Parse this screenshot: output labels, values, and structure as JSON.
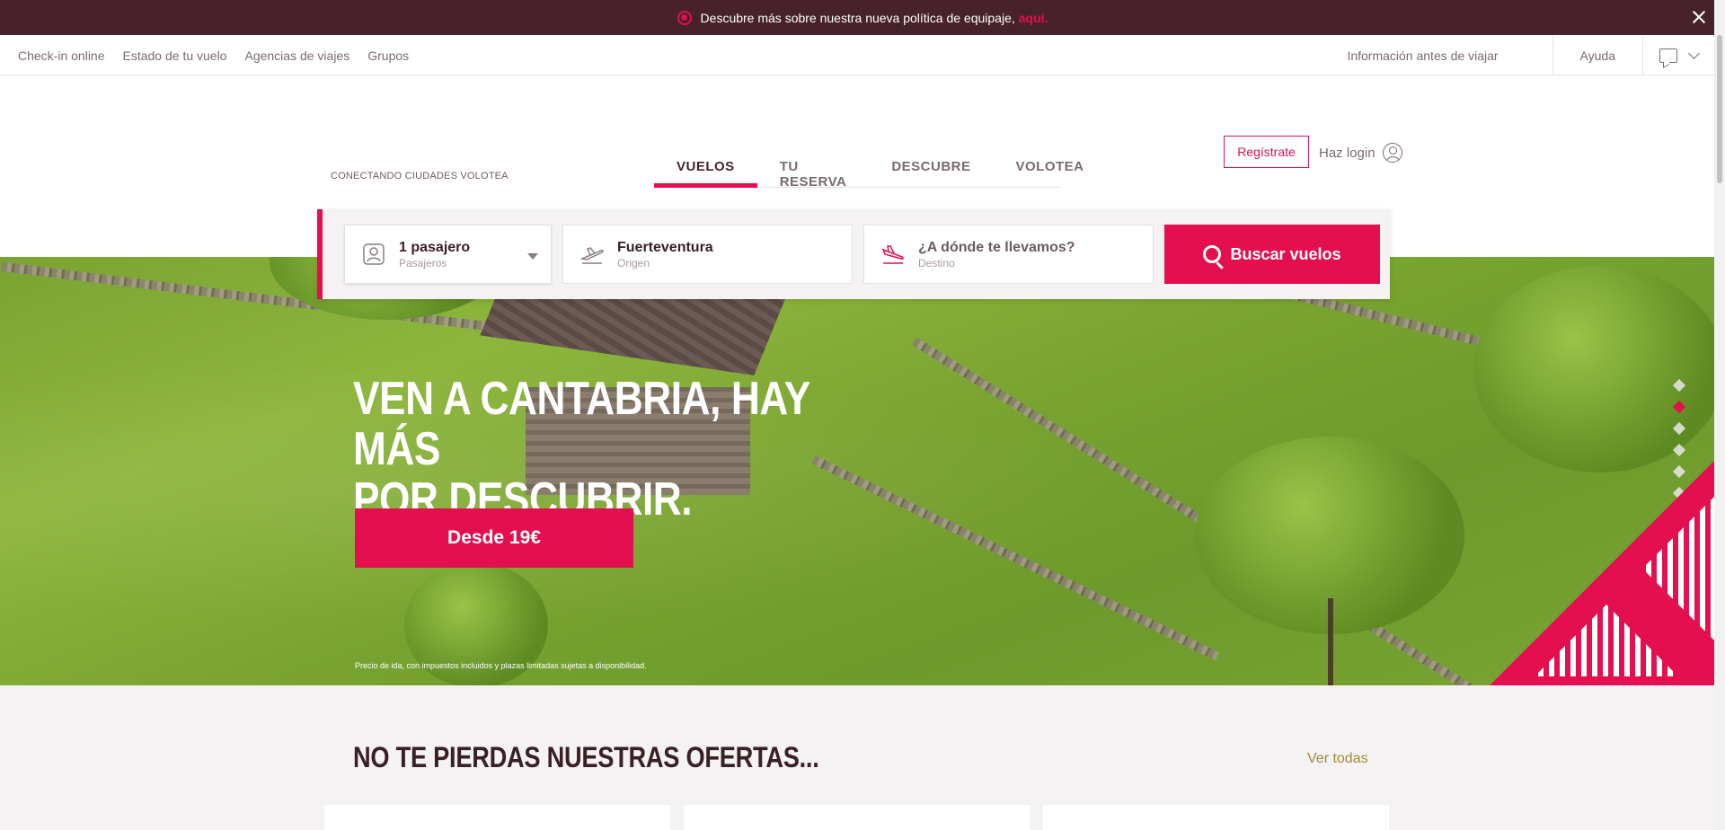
{
  "announcement": {
    "text": "Descubre más sobre nuestra nueva política de equipaje,",
    "link": "aquí."
  },
  "utility": {
    "left_links": [
      "Check-in online",
      "Estado de tu vuelo",
      "Agencias de viajes",
      "Grupos"
    ],
    "info": "Información antes de viajar",
    "help": "Ayuda"
  },
  "header": {
    "tagline": "CONECTANDO CIUDADES VOLOTEA",
    "tabs": [
      "VUELOS",
      "TU RESERVA",
      "DESCUBRE",
      "VOLOTEA"
    ],
    "register_label": "Regístrate",
    "login_label": "Haz login"
  },
  "search": {
    "passengers_value": "1 pasajero",
    "passengers_label": "Pasajeros",
    "origin_value": "Fuerteventura",
    "origin_label": "Origen",
    "destination_placeholder": "¿A dónde te llevamos?",
    "destination_label": "Destino",
    "button_label": "Buscar vuelos"
  },
  "hero": {
    "title_line1": "VEN A CANTABRIA, HAY MÁS",
    "title_line2": "POR DESCUBRIR.",
    "cta_label": "Desde 19€",
    "note": "Precio de ida, con impuestos incluidos y plazas limitadas sujetas a disponibilidad.",
    "slide_count": 6,
    "active_slide": 2
  },
  "offers": {
    "title": "NO TE PIERDAS NUESTRAS OFERTAS...",
    "see_all": "Ver todas"
  },
  "colors": {
    "brand": "#e30f4f",
    "dark": "#47222a",
    "accent_gold": "#a08a36"
  },
  "icons": [
    "close-icon",
    "chat-icon",
    "chevron-down-icon",
    "user-icon",
    "passenger-icon",
    "takeoff-icon",
    "landing-icon",
    "search-icon"
  ]
}
